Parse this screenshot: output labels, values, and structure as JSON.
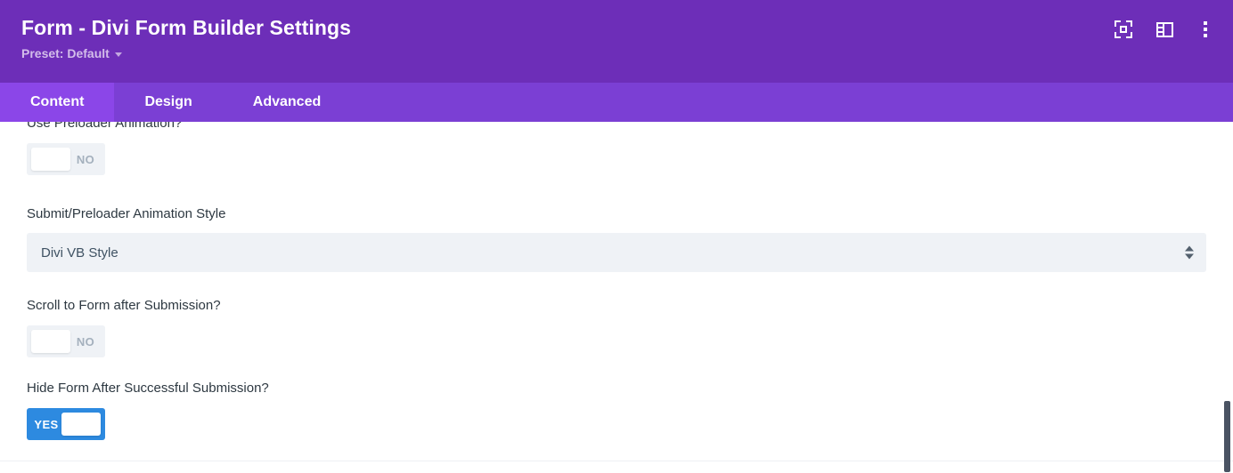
{
  "header": {
    "title": "Form - Divi Form Builder Settings",
    "preset_label": "Preset: Default",
    "preset_caret": "caret-down-icon",
    "icons": [
      {
        "name": "focus-mode-icon",
        "label": "Focus Mode"
      },
      {
        "name": "panel-layout-icon",
        "label": "Panel Layout"
      },
      {
        "name": "kebab-menu-icon",
        "label": "More Options"
      }
    ],
    "background_color": "#6d2eb8"
  },
  "tabs": {
    "active": "Content",
    "background_color": "#7b3fd4",
    "active_color": "#8b46e8",
    "items": [
      {
        "label": "Content",
        "active": true
      },
      {
        "label": "Design",
        "active": false
      },
      {
        "label": "Advanced",
        "active": false
      }
    ]
  },
  "settings": {
    "fields": [
      {
        "name": "use-preloader-animation",
        "label": "Use Preloader Animation?",
        "type": "toggle",
        "value": "NO",
        "on": false,
        "clipped": true
      },
      {
        "name": "submit-preloader-animation-style",
        "label": "Submit/Preloader Animation Style",
        "type": "select",
        "value": "Divi VB Style"
      },
      {
        "name": "scroll-to-form-after-submission",
        "label": "Scroll to Form after Submission?",
        "type": "toggle",
        "value": "NO",
        "on": false
      },
      {
        "name": "hide-form-after-successful-submission",
        "label": "Hide Form After Successful Submission?",
        "type": "toggle",
        "value": "YES",
        "on": true
      }
    ]
  },
  "colors": {
    "toggle_on": "#2d8ae0",
    "toggle_off_bg": "#eff2f6",
    "toggle_off_text": "#a4b0bd",
    "field_bg": "#eff2f6",
    "label_text": "#2d3841",
    "scrollbar_thumb": "#4a5363"
  },
  "scrollbar": {
    "name": "vertical-scrollbar",
    "position": "right"
  }
}
